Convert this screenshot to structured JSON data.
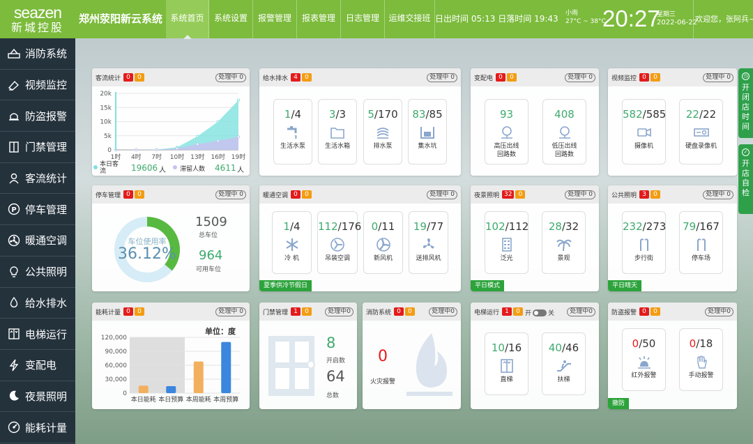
{
  "brand": {
    "en": "seazen",
    "cn": "新城控股"
  },
  "system_title": "郑州荥阳新云系统",
  "nav": [
    "系统首页",
    "系统设置",
    "报警管理",
    "报表管理",
    "日志管理",
    "运维交接班"
  ],
  "sun": {
    "rise_label": "日出时间",
    "rise": "05:13",
    "set_label": "日落时间",
    "set": "19:43"
  },
  "weather": {
    "desc": "小雨",
    "temp": "27°C ~ 38°C"
  },
  "clock": "20:27",
  "date": {
    "weekday": "星期三",
    "date": "2022-06-22"
  },
  "welcome": "欢迎您，张阿兵~",
  "sidebar": [
    {
      "label": "消防系统",
      "icon": "fire-system-icon"
    },
    {
      "label": "视频监控",
      "icon": "video-icon"
    },
    {
      "label": "防盗报警",
      "icon": "alarm-icon"
    },
    {
      "label": "门禁管理",
      "icon": "door-icon"
    },
    {
      "label": "客流统计",
      "icon": "person-icon"
    },
    {
      "label": "停车管理",
      "icon": "parking-icon"
    },
    {
      "label": "暖通空调",
      "icon": "fan-icon"
    },
    {
      "label": "公共照明",
      "icon": "bulb-icon"
    },
    {
      "label": "给水排水",
      "icon": "water-drop-icon"
    },
    {
      "label": "电梯运行",
      "icon": "elevator-icon"
    },
    {
      "label": "变配电",
      "icon": "lightning-icon"
    },
    {
      "label": "夜景照明",
      "icon": "moon-icon"
    },
    {
      "label": "能耗计量",
      "icon": "meter-icon"
    }
  ],
  "status_label": "处理中",
  "status_count": "0",
  "right_tabs": [
    {
      "label": "开闭店时间"
    },
    {
      "label": "开店自检"
    }
  ],
  "panels": {
    "traffic": {
      "title": "客流统计",
      "red": "0",
      "orange": "0",
      "legend1": "本日客流",
      "value1": "19606",
      "unit1": "人",
      "legend2": "滞留人数",
      "value2": "4611",
      "unit2": "人"
    },
    "water": {
      "title": "给水排水",
      "red": "4",
      "orange": "0",
      "items": [
        {
          "cur": "1",
          "total": "/4",
          "label": "生活水泵",
          "icon": "faucet-icon"
        },
        {
          "cur": "3",
          "total": "/3",
          "label": "生活水箱",
          "icon": "tank-icon"
        },
        {
          "cur": "5",
          "total": "/170",
          "label": "排水泵",
          "icon": "drain-pump-icon"
        },
        {
          "cur": "83",
          "total": "/85",
          "label": "集水坑",
          "icon": "sump-icon"
        }
      ]
    },
    "power": {
      "title": "变配电",
      "red": "0",
      "orange": "0",
      "items": [
        {
          "cur": "93",
          "label1": "高压出线",
          "label2": "回路数",
          "icon": "hv-line-icon"
        },
        {
          "cur": "408",
          "label1": "低压出线",
          "label2": "回路数",
          "icon": "lv-line-icon"
        }
      ]
    },
    "video": {
      "title": "视频监控",
      "red": "0",
      "orange": "0",
      "items": [
        {
          "cur": "582",
          "total": "/585",
          "label": "摄像机",
          "icon": "camera-icon"
        },
        {
          "cur": "22",
          "total": "/22",
          "label": "硬盘录像机",
          "icon": "dvr-icon"
        }
      ]
    },
    "parking": {
      "title": "停车管理",
      "red": "0",
      "orange": "0",
      "rate_label": "车位使用率",
      "rate": "36.12%",
      "rate_value": 36.12,
      "total": "1509",
      "total_label": "总车位",
      "avail": "964",
      "avail_label": "可用车位"
    },
    "hvac": {
      "title": "暖通空调",
      "red": "0",
      "orange": "0",
      "mode": "夏季供冷节假日",
      "items": [
        {
          "cur": "1",
          "total": "/4",
          "label": "冷 机",
          "icon": "snowflake-icon"
        },
        {
          "cur": "112",
          "total": "/176",
          "label": "吊装空调",
          "icon": "ac-fan-icon"
        },
        {
          "cur": "0",
          "total": "/11",
          "label": "新风机",
          "icon": "fresh-air-icon"
        },
        {
          "cur": "19",
          "total": "/77",
          "label": "送排风机",
          "icon": "exhaust-fan-icon"
        }
      ]
    },
    "night": {
      "title": "夜景照明",
      "red": "32",
      "orange": "0",
      "mode": "平日模式",
      "items": [
        {
          "cur": "102",
          "total": "/112",
          "label": "泛光",
          "icon": "building-light-icon"
        },
        {
          "cur": "28",
          "total": "/32",
          "label": "景观",
          "icon": "palm-tree-icon"
        }
      ]
    },
    "publight": {
      "title": "公共照明",
      "red": "3",
      "orange": "0",
      "mode": "平日晴天",
      "items": [
        {
          "cur": "232",
          "total": "/273",
          "label": "步行街",
          "icon": "walkway-icon"
        },
        {
          "cur": "79",
          "total": "/167",
          "label": "停车场",
          "icon": "parking-light-icon"
        }
      ]
    },
    "energy": {
      "title": "能耗计量",
      "red": "0",
      "orange": "0",
      "unit": "单位：度"
    },
    "door": {
      "title": "门禁管理",
      "red": "1",
      "orange": "0",
      "open": "8",
      "open_label": "开启数",
      "total": "64",
      "total_label": "总数"
    },
    "fire": {
      "title": "消防系统",
      "red": "0",
      "orange": "0",
      "value": "0",
      "label": "火灾报警"
    },
    "elevator": {
      "title": "电梯运行",
      "red": "1",
      "orange": "0",
      "on": "开",
      "off": "关",
      "items": [
        {
          "cur": "10",
          "total": "/16",
          "label": "直梯",
          "icon": "lift-icon"
        },
        {
          "cur": "40",
          "total": "/46",
          "label": "扶梯",
          "icon": "escalator-icon"
        }
      ]
    },
    "antitheft": {
      "title": "防盗报警",
      "red": "0",
      "orange": "0",
      "mode": "撤防",
      "items": [
        {
          "cur": "0",
          "total": "/50",
          "label": "红外报警",
          "icon": "infrared-icon"
        },
        {
          "cur": "0",
          "total": "/18",
          "label": "手动报警",
          "icon": "hand-alarm-icon"
        }
      ]
    }
  },
  "chart_data": [
    {
      "type": "area",
      "x": [
        "1时",
        "4时",
        "7时",
        "10时",
        "13时",
        "16时",
        "19时"
      ],
      "y_ticks": [
        "0",
        "5k",
        "10k",
        "15k",
        "20k"
      ],
      "ylim": [
        0,
        20000
      ],
      "series": [
        {
          "name": "本日客流",
          "color": "#7fe2df",
          "values": [
            0,
            40,
            80,
            900,
            4800,
            10000,
            17600
          ]
        },
        {
          "name": "滞留人数",
          "color": "#c5c4ef",
          "values": [
            0,
            20,
            50,
            500,
            2000,
            3200,
            4600
          ]
        }
      ]
    },
    {
      "type": "bar",
      "categories": [
        "本日能耗",
        "本日预算",
        "本周能耗",
        "本周预算"
      ],
      "y_ticks": [
        "0",
        "30,000",
        "60,000",
        "90,000",
        "120,000"
      ],
      "ylim": [
        0,
        120000
      ],
      "values": [
        16000,
        15000,
        68000,
        110000
      ],
      "colors": [
        "#f2b05e",
        "#3b86de",
        "#f2b05e",
        "#3b86de"
      ]
    }
  ]
}
